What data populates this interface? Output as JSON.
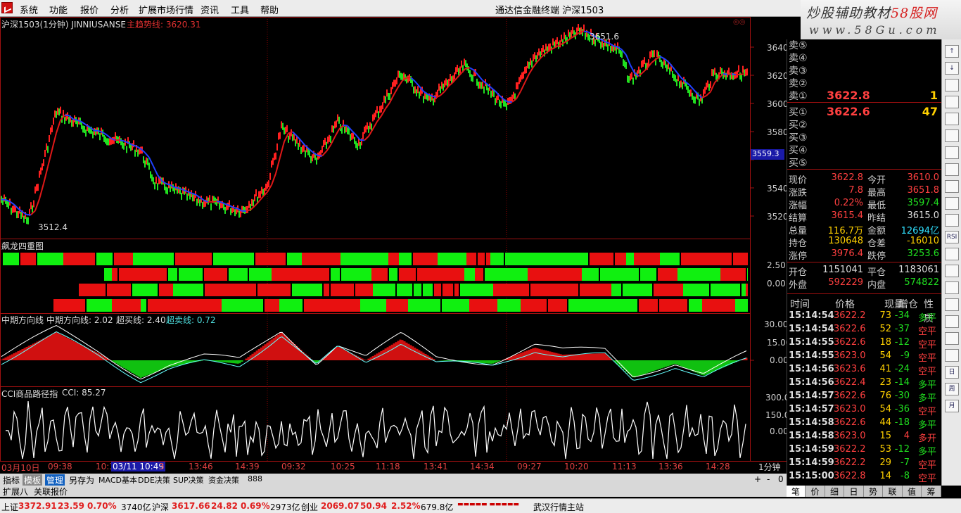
{
  "menubar": {
    "items": [
      "系统",
      "功能",
      "报价",
      "分析",
      "扩展市场行情",
      "资讯",
      "工具",
      "帮助"
    ],
    "title": "通达信金融终端  沪深1503"
  },
  "brand": {
    "line1": "炒股辅助教材",
    "line2": "58股网",
    "line3": "www.58Gu.com"
  },
  "main_chart": {
    "title": "沪深1503(1分钟) JINNIUSANSE",
    "indicator": "主趋势线: 3620.31",
    "high_label": "3651.6",
    "low_label": "3512.4",
    "current_price_tag": "3559.3",
    "yaxis": [
      "3640",
      "3620",
      "3600",
      "3580",
      "3560",
      "3540",
      "3520"
    ]
  },
  "dragon": {
    "title": "飙龙四重图",
    "yaxis": [
      "2.50",
      "0.00"
    ]
  },
  "mid": {
    "title": "中期方向线",
    "line1": "中期方向线: 2.02",
    "line2": "超买线: 2.40",
    "line3": "超卖线: 0.72",
    "yaxis": [
      "30.00",
      "15.00",
      "0.00"
    ]
  },
  "cci": {
    "title": "CCI商品路径指",
    "value": "CCI: 85.27",
    "yaxis": [
      "300.0",
      "150.0",
      "0.00"
    ]
  },
  "time_axis": {
    "labels": [
      "03月10日",
      "09:38",
      "10:3",
      "03/11 10:49",
      "3",
      "13:46",
      "14:39",
      "09:32",
      "10:25",
      "11:18",
      "13:41",
      "14:34",
      "09:27",
      "10:20",
      "11:13",
      "13:36",
      "14:28"
    ],
    "period": "1分钟"
  },
  "tabs": {
    "row1": [
      "指标",
      "模板",
      "管理",
      "另存为",
      "MACD基本",
      "DDE决策",
      "SUP决策",
      "资金决策",
      "888"
    ],
    "row2": [
      "扩展八",
      "关联报价"
    ],
    "controls": [
      "+",
      "-",
      "0"
    ]
  },
  "quotes": {
    "asks": [
      {
        "label": "卖⑤"
      },
      {
        "label": "卖④"
      },
      {
        "label": "卖③"
      },
      {
        "label": "卖②"
      },
      {
        "label": "卖①",
        "price": "3622.8",
        "vol": "1"
      }
    ],
    "bids": [
      {
        "label": "买①",
        "price": "3622.6",
        "vol": "47"
      },
      {
        "label": "买②"
      },
      {
        "label": "买③"
      },
      {
        "label": "买④"
      },
      {
        "label": "买⑤"
      }
    ],
    "stats": [
      {
        "k1": "现价",
        "v1": "3622.8",
        "k2": "今开",
        "v2": "3610.0",
        "c1": "up",
        "c2": "up"
      },
      {
        "k1": "涨跌",
        "v1": "7.8",
        "k2": "最高",
        "v2": "3651.8",
        "c1": "up",
        "c2": "up"
      },
      {
        "k1": "涨幅",
        "v1": "0.22%",
        "k2": "最低",
        "v2": "3597.4",
        "c1": "up",
        "c2": "dn"
      },
      {
        "k1": "结算",
        "v1": "3615.4",
        "k2": "昨结",
        "v2": "3615.0",
        "c1": "up",
        "c2": "wh"
      },
      {
        "k1": "总量",
        "v1": "116.7万",
        "k2": "金额",
        "v2": "12694亿",
        "c1": "yl",
        "c2": "cy"
      },
      {
        "k1": "持仓",
        "v1": "130648",
        "k2": "仓差",
        "v2": "-16010",
        "c1": "yl",
        "c2": "yl"
      },
      {
        "k1": "涨停",
        "v1": "3976.4",
        "k2": "跌停",
        "v2": "3253.6",
        "c1": "up",
        "c2": "dn"
      }
    ],
    "oi": [
      {
        "k1": "开仓",
        "v1": "1151041",
        "k2": "平仓",
        "v2": "1183061"
      },
      {
        "k1": "外盘",
        "v1": "592229",
        "k2": "内盘",
        "v2": "574822"
      }
    ],
    "tick_headers": [
      "时间",
      "价格",
      "现量",
      "增仓",
      "性质"
    ],
    "ticks": [
      {
        "t": "15:14:54",
        "p": "3622.2",
        "v": "73",
        "d": "-34",
        "n": "多平",
        "nc": "dn"
      },
      {
        "t": "15:14:54",
        "p": "3622.6",
        "v": "52",
        "d": "-37",
        "n": "空平",
        "nc": "up"
      },
      {
        "t": "15:14:55",
        "p": "3622.6",
        "v": "18",
        "d": "-12",
        "n": "空平",
        "nc": "up"
      },
      {
        "t": "15:14:55",
        "p": "3623.0",
        "v": "54",
        "d": "-9",
        "n": "空平",
        "nc": "up"
      },
      {
        "t": "15:14:56",
        "p": "3623.6",
        "v": "41",
        "d": "-24",
        "n": "空平",
        "nc": "up"
      },
      {
        "t": "15:14:56",
        "p": "3622.4",
        "v": "23",
        "d": "-14",
        "n": "多平",
        "nc": "dn"
      },
      {
        "t": "15:14:57",
        "p": "3622.6",
        "v": "76",
        "d": "-30",
        "n": "多平",
        "nc": "dn"
      },
      {
        "t": "15:14:57",
        "p": "3623.0",
        "v": "54",
        "d": "-36",
        "n": "空平",
        "nc": "up"
      },
      {
        "t": "15:14:58",
        "p": "3622.6",
        "v": "44",
        "d": "-18",
        "n": "多平",
        "nc": "dn"
      },
      {
        "t": "15:14:58",
        "p": "3623.0",
        "v": "15",
        "d": "4",
        "n": "多开",
        "nc": "up"
      },
      {
        "t": "15:14:59",
        "p": "3622.2",
        "v": "53",
        "d": "-12",
        "n": "多平",
        "nc": "dn"
      },
      {
        "t": "15:14:59",
        "p": "3622.2",
        "v": "29",
        "d": "-7",
        "n": "空平",
        "nc": "up"
      },
      {
        "t": "15:15:00",
        "p": "3622.8",
        "v": "14",
        "d": "-8",
        "n": "空平",
        "nc": "up"
      }
    ],
    "bottom_tabs": [
      "笔",
      "价",
      "细",
      "日",
      "势",
      "联",
      "值",
      "筹"
    ]
  },
  "toolbar": {
    "labels": [
      "↑",
      "↓",
      "",
      "",
      "",
      "",
      "",
      "",
      "",
      "",
      "",
      "RSI",
      "",
      "",
      "",
      "",
      "",
      "",
      "",
      "日",
      "周",
      "月"
    ]
  },
  "status": {
    "items": [
      {
        "name": "上证",
        "v": "3372.91",
        "c": "23.59",
        "p": "0.70%",
        "a": "3740亿"
      },
      {
        "name": "沪深",
        "v": "3617.66",
        "c": "24.82",
        "p": "0.69%",
        "a": "2973亿"
      },
      {
        "name": "创业",
        "v": "2069.07",
        "c": "50.94",
        "p": "2.52%",
        "a": "679.8亿"
      }
    ],
    "server": "武汉行情主站"
  },
  "colors": {
    "up": "#e02020",
    "down": "#10b010",
    "grid": "#8b0000",
    "panel_border": "#a01010",
    "trend_blue": "#2040ff"
  }
}
